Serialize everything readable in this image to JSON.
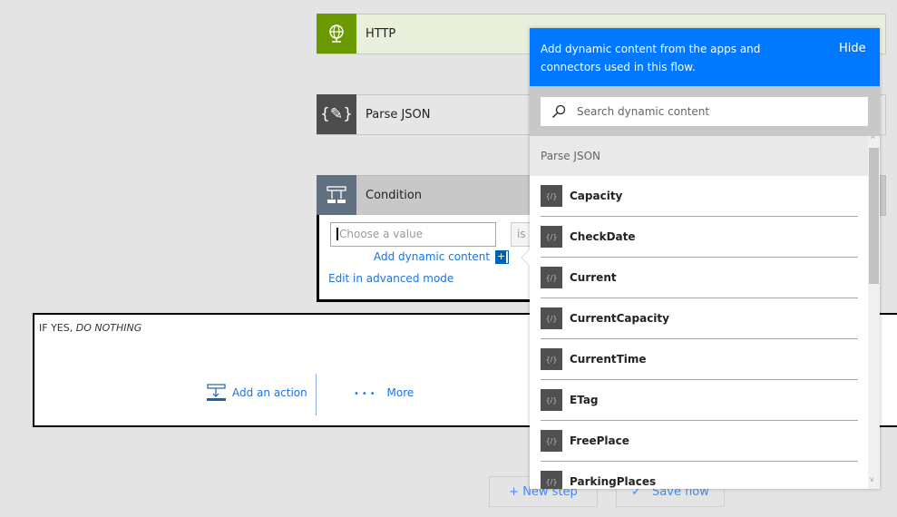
{
  "steps": [
    {
      "title": "HTTP",
      "icon": "globe-icon",
      "color": "#6b9a00",
      "bg": "#e8efdb"
    },
    {
      "title": "Parse JSON",
      "icon": "braces-icon",
      "color": "#4d4d4d",
      "bg": "#e6e6e6"
    },
    {
      "title": "Condition",
      "icon": "condition-icon",
      "color": "#607080",
      "bg": "#c8c8c8"
    }
  ],
  "condition": {
    "value_placeholder": "Choose a value",
    "operator": "is e",
    "add_dynamic": "Add dynamic content",
    "advanced": "Edit in advanced mode"
  },
  "branch": {
    "label_prefix": "IF YES, ",
    "label_italic": "DO NOTHING",
    "add_action": "Add an action",
    "more": "More"
  },
  "footer": {
    "new_step": "+ New step",
    "save_flow": "Save flow"
  },
  "popup": {
    "header": "Add dynamic content from the apps and connectors used in this flow.",
    "hide": "Hide",
    "accent": "#0078ff",
    "search_placeholder": "Search dynamic content",
    "group": "Parse JSON",
    "items": [
      "Capacity",
      "CheckDate",
      "Current",
      "CurrentCapacity",
      "CurrentTime",
      "ETag",
      "FreePlace",
      "ParkingPlaces"
    ]
  }
}
